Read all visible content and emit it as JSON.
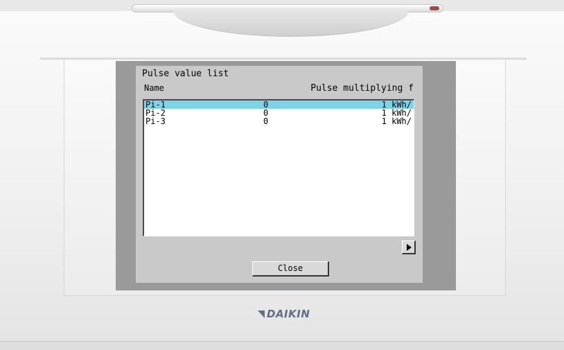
{
  "dialog": {
    "title": "Pulse value list",
    "name_header": "Name",
    "multiplier_header": "Pulse multiplying f",
    "rows": [
      {
        "name": "Pi-1",
        "value": "0",
        "multiplier": "1 kWh/",
        "selected": true
      },
      {
        "name": "Pi-2",
        "value": "0",
        "multiplier": "1 kWh/",
        "selected": false
      },
      {
        "name": "Pi-3",
        "value": "0",
        "multiplier": "1 kWh/",
        "selected": false
      }
    ],
    "close_label": "Close",
    "scroll_icon": "triangle-right-icon",
    "selection_color": "#7fd3e6"
  },
  "brand": {
    "logo_text": "DAIKIN",
    "color": "#5f6f86"
  }
}
